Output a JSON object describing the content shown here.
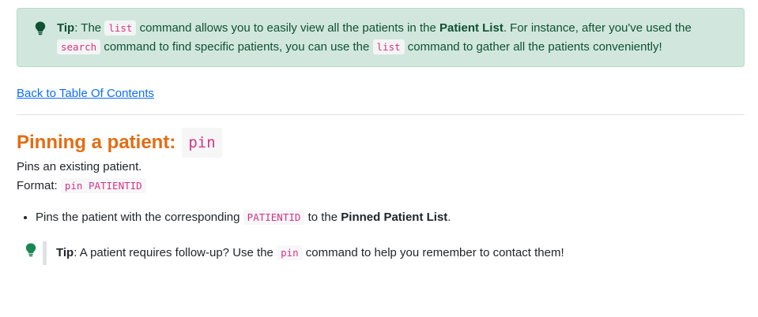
{
  "tip_box": {
    "label": "Tip",
    "text_1": ": The ",
    "code_1": "list",
    "text_2": " command allows you to easily view all the patients in the ",
    "bold_1": "Patient List",
    "text_3": ". For instance, after you've used the ",
    "code_2": "search",
    "text_4": " command to find specific patients, you can use the ",
    "code_3": "list",
    "text_5": " command to gather all the patients conveniently!"
  },
  "back_link": "Back to Table Of Contents",
  "section": {
    "heading_text": "Pinning a patient: ",
    "heading_code": "pin",
    "description": "Pins an existing patient.",
    "format_label": "Format: ",
    "format_code": "pin PATIENTID",
    "bullet": {
      "text_1": "Pins the patient with the corresponding ",
      "code": "PATIENTID",
      "text_2": " to the ",
      "bold": "Pinned Patient List",
      "text_3": "."
    },
    "tip": {
      "label": "Tip",
      "text_1": ": A patient requires follow-up? Use the ",
      "code": "pin",
      "text_2": " command to help you remember to contact them!"
    }
  },
  "icons": {
    "tip_icon": "lightbulb-icon"
  },
  "colors": {
    "tip_bg": "#d1e7dd",
    "tip_text": "#0f5132",
    "heading": "#e46c12",
    "code": "#d63384",
    "link": "#0d6efd"
  }
}
